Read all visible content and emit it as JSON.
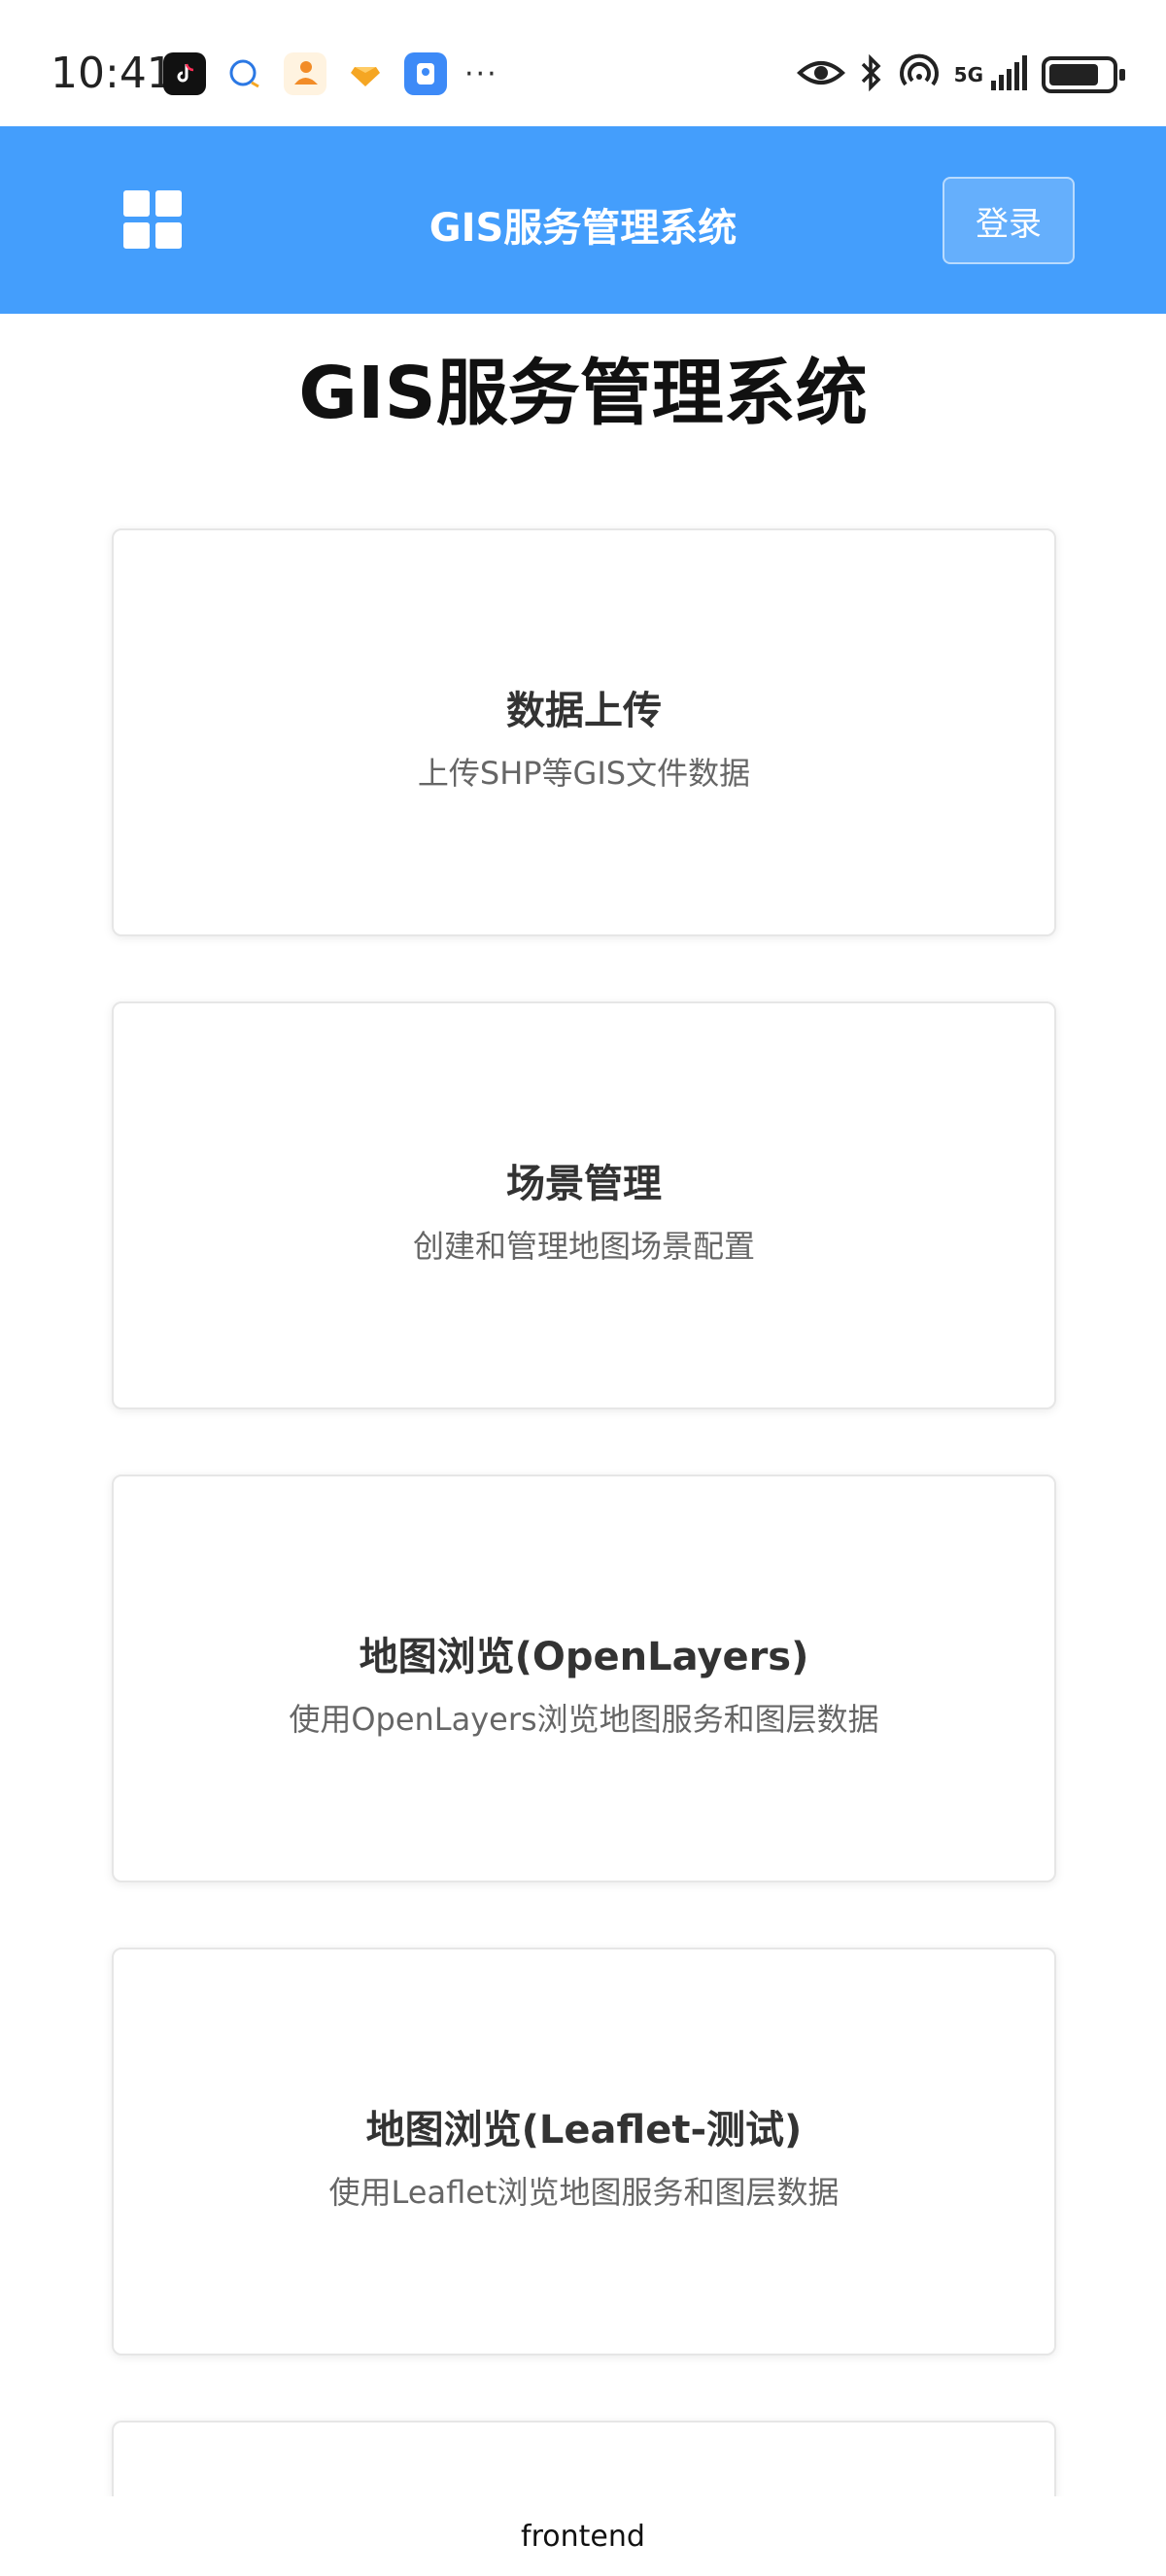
{
  "status_bar": {
    "time": "10:41",
    "more": "···",
    "network": "5G",
    "icons": [
      "tiktok-icon",
      "chat-icon",
      "delivery-icon",
      "gem-icon",
      "shield-app-icon",
      "eye-icon",
      "bluetooth-icon",
      "hotspot-icon",
      "signal-icon",
      "battery-icon"
    ]
  },
  "header": {
    "title": "GIS服务管理系统",
    "login_label": "登录",
    "menu_icon": "grid-icon",
    "background": "#449efc"
  },
  "page": {
    "title": "GIS服务管理系统"
  },
  "cards": [
    {
      "title": "数据上传",
      "description": "上传SHP等GIS文件数据"
    },
    {
      "title": "场景管理",
      "description": "创建和管理地图场景配置"
    },
    {
      "title": "地图浏览(OpenLayers)",
      "description": "使用OpenLayers浏览地图服务和图层数据"
    },
    {
      "title": "地图浏览(Leaflet-测试)",
      "description": "使用Leaflet浏览地图服务和图层数据"
    }
  ],
  "footer": {
    "label": "frontend"
  }
}
